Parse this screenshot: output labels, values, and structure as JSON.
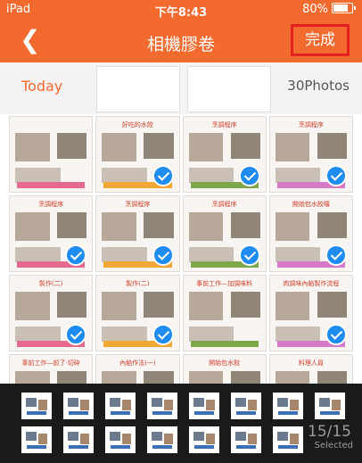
{
  "status": {
    "carrier": "iPad",
    "time": "下午8:43",
    "battery": "80%"
  },
  "nav": {
    "back_icon": "chevron-left-icon",
    "title": "相機膠卷",
    "done_label": "完成"
  },
  "section": {
    "today": "Today",
    "photo_count": "30Photos"
  },
  "grid": {
    "rows": [
      [
        {
          "caption": "",
          "checked": false
        },
        {
          "caption": "好吃的水餃",
          "checked": true
        },
        {
          "caption": "烹調程序",
          "checked": true
        },
        {
          "caption": "烹調程序",
          "checked": true
        }
      ],
      [
        {
          "caption": "烹調程序",
          "checked": true
        },
        {
          "caption": "烹調程序",
          "checked": true
        },
        {
          "caption": "烹調程序",
          "checked": true
        },
        {
          "caption": "開始包水餃囉",
          "checked": true
        }
      ],
      [
        {
          "caption": "製作(二)",
          "checked": true
        },
        {
          "caption": "製作(二)",
          "checked": true
        },
        {
          "caption": "事前工作—加調味料",
          "checked": false
        },
        {
          "caption": "肉調味內餡製作流程",
          "checked": true
        }
      ],
      [
        {
          "caption": "事前工作—前了·切碎",
          "checked": false
        },
        {
          "caption": "內餡作法(一)",
          "checked": false
        },
        {
          "caption": "開始包水餃",
          "checked": false
        },
        {
          "caption": "料理人員",
          "checked": false
        }
      ]
    ]
  },
  "tray": {
    "selected_count": "15/15",
    "selected_label": "Selected"
  },
  "colors": {
    "accent": "#f36a2f",
    "check": "#1e8cf0",
    "highlight": "#e52020"
  }
}
